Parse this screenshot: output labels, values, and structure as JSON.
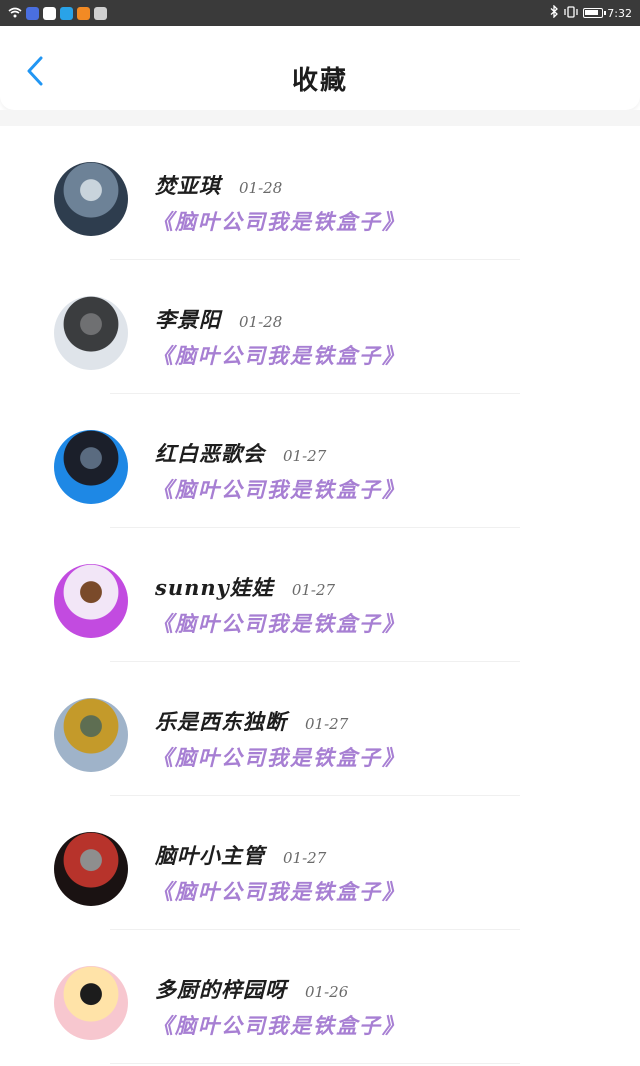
{
  "status_bar": {
    "time": "7:32",
    "app_icon_colors": [
      "#4a6fe0",
      "#ffffff",
      "#29a3e8",
      "#f28a24",
      "#d0d0d0"
    ]
  },
  "header": {
    "title": "收藏",
    "accent_color": "#2196f3"
  },
  "book_color": "#a77fd3",
  "items": [
    {
      "name": "焚亚琪",
      "date": "01-28",
      "book": "《脑叶公司我是铁盒子》",
      "avatar": "hooded-anime-boy",
      "avatar_colors": [
        "#2e3d4e",
        "#6d8297",
        "#c9d4dc"
      ]
    },
    {
      "name": "李景阳",
      "date": "01-28",
      "book": "《脑叶公司我是铁盒子》",
      "avatar": "temple-building",
      "avatar_colors": [
        "#dfe4ea",
        "#3b3d3f",
        "#6f7072"
      ]
    },
    {
      "name": "红白恶歌会",
      "date": "01-27",
      "book": "《脑叶公司我是铁盒子》",
      "avatar": "dark-anime-figure",
      "avatar_colors": [
        "#1e88e5",
        "#1b1f2a",
        "#5a6b80"
      ]
    },
    {
      "name": "sunny娃娃",
      "date": "01-27",
      "book": "《脑叶公司我是铁盒子》",
      "avatar": "purple-chibi",
      "avatar_colors": [
        "#c24be0",
        "#f2e6f7",
        "#7a4a2a"
      ]
    },
    {
      "name": "乐是西东独断",
      "date": "01-27",
      "book": "《脑叶公司我是铁盒子》",
      "avatar": "golden-statue",
      "avatar_colors": [
        "#9fb3c9",
        "#c49a2a",
        "#5e6e52"
      ]
    },
    {
      "name": "脑叶小主管",
      "date": "01-27",
      "book": "《脑叶公司我是铁盒子》",
      "avatar": "dark-chibi",
      "avatar_colors": [
        "#1a1212",
        "#b7332b",
        "#8e8e8e"
      ]
    },
    {
      "name": "多厨的梓园呀",
      "date": "01-26",
      "book": "《脑叶公司我是铁盒子》",
      "avatar": "bunny-girl",
      "avatar_colors": [
        "#f7c7cf",
        "#ffe3a8",
        "#1c1c1c"
      ]
    }
  ]
}
